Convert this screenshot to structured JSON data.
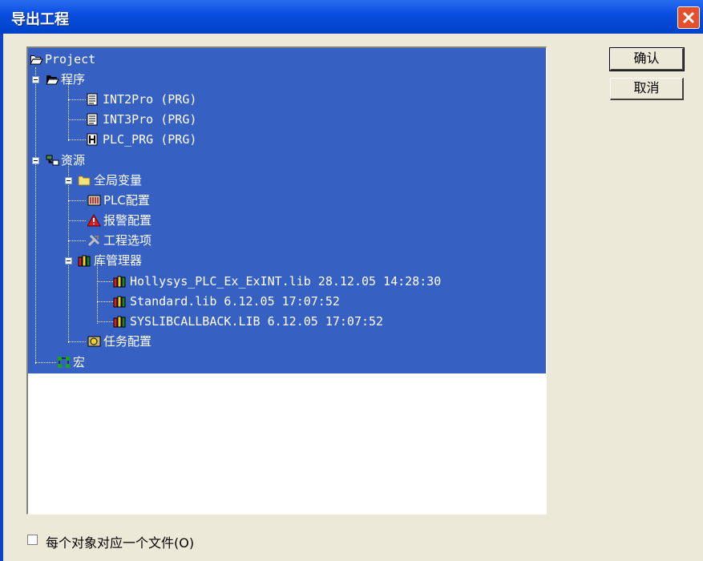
{
  "window": {
    "title": "导出工程",
    "close_icon": "close-icon"
  },
  "buttons": {
    "ok": "确认",
    "cancel": "取消"
  },
  "tree": {
    "root": "Project",
    "programs": {
      "label": "程序",
      "items": [
        "INT2Pro (PRG)",
        "INT3Pro (PRG)",
        "PLC_PRG (PRG)"
      ]
    },
    "resources": {
      "label": "资源",
      "items": [
        "全局变量",
        "PLC配置",
        "报警配置",
        "工程选项",
        "库管理器",
        "任务配置"
      ],
      "libraries": [
        "Hollysys_PLC_Ex_ExINT.lib 28.12.05 14:28:30",
        "Standard.lib 6.12.05 17:07:52",
        "SYSLIBCALLBACK.LIB 6.12.05 17:07:52"
      ]
    },
    "macro": "宏"
  },
  "checkbox": {
    "label": "每个对象对应一个文件(O)",
    "checked": false
  },
  "colors": {
    "selection": "#3760c3",
    "titlebar": "#0a4fe0",
    "dialog": "#ece9d8"
  }
}
